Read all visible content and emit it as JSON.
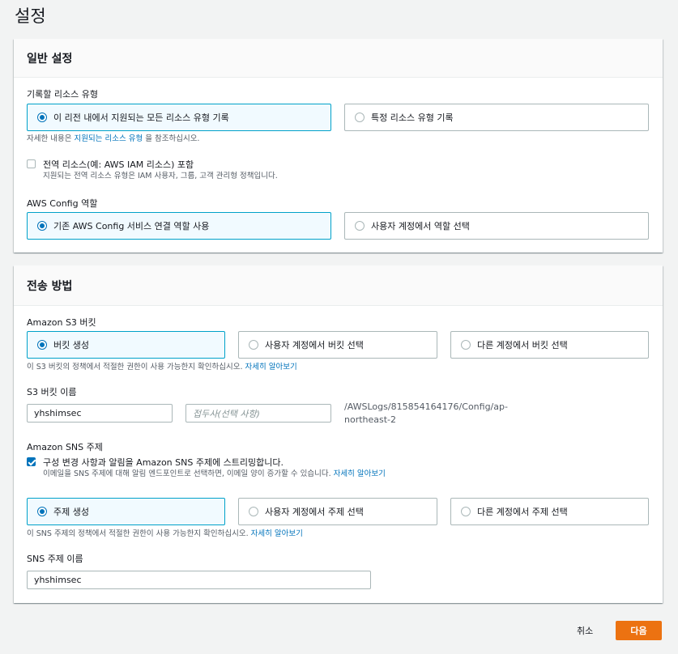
{
  "page": {
    "title": "설정"
  },
  "general": {
    "header": "일반 설정",
    "resource_type_label": "기록할 리소스 유형",
    "option_all": "이 리전 내에서 지원되는 모든 리소스 유형 기록",
    "option_specific": "특정 리소스 유형 기록",
    "help_prefix": "자세한 내용은",
    "help_link": "지원되는 리소스 유형",
    "help_suffix": "을 참조하십시오.",
    "global_checkbox_label": "전역 리소스(예: AWS IAM 리소스) 포함",
    "global_checkbox_desc": "지원되는 전역 리소스 유형은 IAM 사용자, 그룹, 고객 관리형 정책입니다.",
    "global_checked": false,
    "role_label": "AWS Config 역할",
    "role_option_existing": "기존 AWS Config 서비스 연결 역할 사용",
    "role_option_choose": "사용자 계정에서 역할 선택"
  },
  "delivery": {
    "header": "전송 방법",
    "s3_label": "Amazon S3 버킷",
    "s3_option_create": "버킷 생성",
    "s3_option_own": "사용자 계정에서 버킷 선택",
    "s3_option_other": "다른 계정에서 버킷 선택",
    "s3_help": "이 S3 버킷의 정책에서 적절한 권한이 사용 가능한지 확인하십시오.",
    "s3_help_link": "자세히 알아보기",
    "bucket_name_label": "S3 버킷 이름",
    "bucket_name_value": "yhshimsec",
    "prefix_placeholder": "접두사(선택 사항)",
    "path_text": "/AWSLogs/815854164176/Config/ap-northeast-2",
    "sns_label": "Amazon SNS 주제",
    "sns_checkbox_label": "구성 변경 사항과 알림을 Amazon SNS 주제에 스트리밍합니다.",
    "sns_checkbox_desc": "이메일을 SNS 주제에 대해 알림 엔드포인트로 선택하면, 이메일 양이 증가할 수 있습니다.",
    "sns_checkbox_link": "자세히 알아보기",
    "sns_checked": true,
    "topic_option_create": "주제 생성",
    "topic_option_own": "사용자 계정에서 주제 선택",
    "topic_option_other": "다른 계정에서 주제 선택",
    "topic_help": "이 SNS 주제의 정책에서 적절한 권한이 사용 가능한지 확인하십시오.",
    "topic_help_link": "자세히 알아보기",
    "topic_name_label": "SNS 주제 이름",
    "topic_name_value": "yhshimsec"
  },
  "footer": {
    "cancel_label": "취소",
    "next_label": "다음"
  },
  "colors": {
    "accent": "#0073bb",
    "selected_border": "#00a1c9",
    "primary_button": "#ec7211"
  }
}
